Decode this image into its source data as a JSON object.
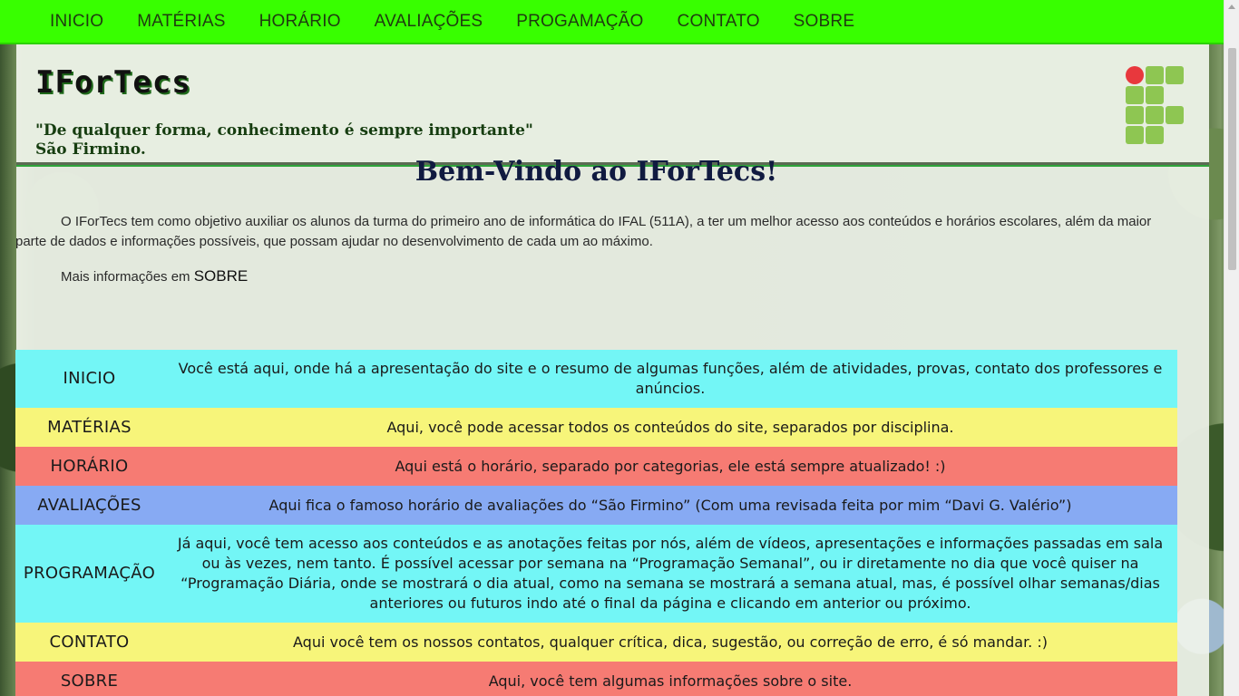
{
  "nav": {
    "items": [
      "INICIO",
      "MATÉRIAS",
      "HORÁRIO",
      "AVALIAÇÕES",
      "PROGAMAÇÃO",
      "CONTATO",
      "SOBRE"
    ]
  },
  "header": {
    "logo_text": "IForTecs",
    "quote_line1": "\"De qualquer forma, conhecimento é sempre importante\"",
    "quote_line2": "São Firmino."
  },
  "main": {
    "welcome": "Bem-Vindo ao IForTecs!",
    "intro": "O IForTecs tem como objetivo auxiliar os alunos da turma do primeiro ano de informática do IFAL (511A), a ter um melhor acesso aos conteúdos e horários escolares, além da maior parte de dados e informações possíveis, que possam ajudar no desenvolvimento de cada um ao máximo.",
    "more_prefix": "Mais informações em",
    "more_link": "SOBRE"
  },
  "table": {
    "rows": [
      {
        "label": "INICIO",
        "text": "Você está aqui, onde há a apresentação do site e o resumo de algumas funções, além de atividades, provas, contato dos professores e anúncios.",
        "color": "#73f6f6"
      },
      {
        "label": "MATÉRIAS",
        "text": "Aqui, você pode acessar todos os conteúdos do site, separados por disciplina.",
        "color": "#f7f57a"
      },
      {
        "label": "HORÁRIO",
        "text": "Aqui está o horário, separado por categorias, ele está sempre atualizado! :)",
        "color": "#f67b73"
      },
      {
        "label": "AVALIAÇÕES",
        "text": "Aqui fica o famoso horário de avaliações do “São Firmino” (Com uma revisada feita por mim “Davi G. Valério”)",
        "color": "#87aaf3"
      },
      {
        "label": "PROGRAMAÇÃO",
        "text": "Já aqui, você tem acesso aos conteúdos e as anotações feitas por nós, além de vídeos, apresentações e informações passadas em sala ou às vezes, nem tanto. É possível acessar por semana na “Programação Semanal”, ou ir diretamente no dia que você quiser na “Programação Diária, onde se mostrará o dia atual, como na semana se mostrará a semana atual, mas, é possível olhar semanas/dias anteriores ou futuros indo até o final da página e clicando em anterior ou próximo.",
        "color": "#73f6f6"
      },
      {
        "label": "CONTATO",
        "text": "Aqui você tem os nossos contatos, qualquer crítica, dica, sugestão, ou correção de erro, é só mandar. :)",
        "color": "#f7f57a"
      },
      {
        "label": "SOBRE",
        "text": "Aqui, você tem algumas informações sobre o site.",
        "color": "#f67b73"
      }
    ]
  },
  "icons": {
    "logo": "if-institute-logo-icon"
  }
}
